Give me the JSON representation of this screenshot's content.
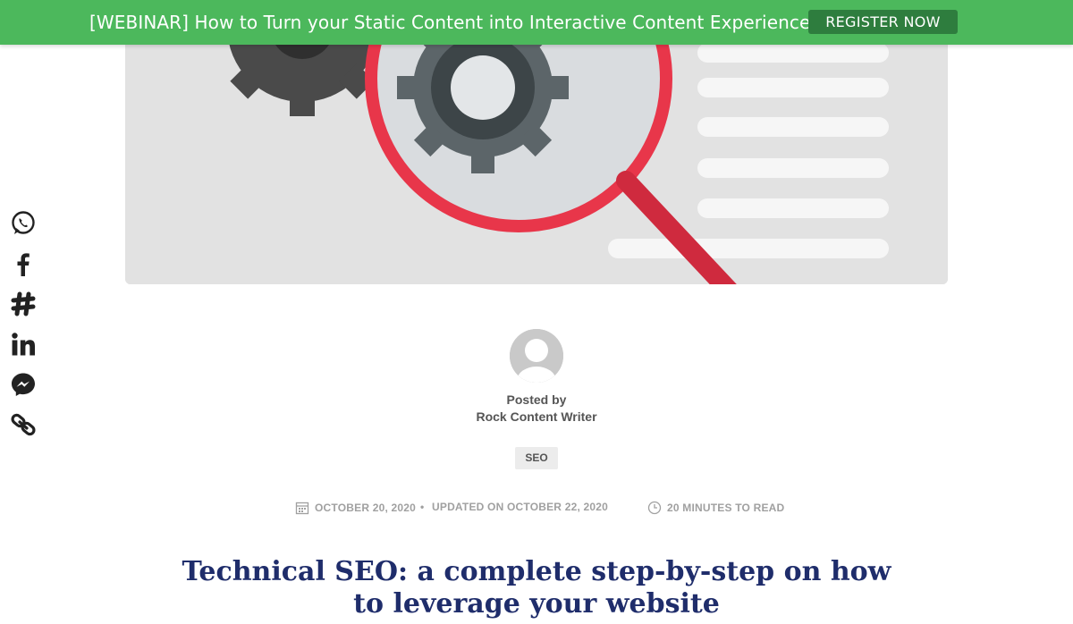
{
  "banner": {
    "text": "[WEBINAR] How to Turn your Static Content into Interactive Content Experiences",
    "button_label": "REGISTER NOW",
    "bg_color": "#4cb85c",
    "button_color": "#2e7d3e"
  },
  "share": {
    "items": [
      {
        "icon": "whatsapp-icon"
      },
      {
        "icon": "facebook-icon"
      },
      {
        "icon": "slack-icon"
      },
      {
        "icon": "linkedin-icon"
      },
      {
        "icon": "messenger-icon"
      },
      {
        "icon": "link-icon"
      }
    ]
  },
  "author": {
    "posted_by_label": "Posted by",
    "name": "Rock Content Writer"
  },
  "tag": {
    "label": "SEO"
  },
  "meta": {
    "date": "OCTOBER 20, 2020",
    "separator": "•",
    "updated": "UPDATED ON OCTOBER 22, 2020",
    "read_time": "20 MINUTES TO READ"
  },
  "article": {
    "title": "Technical SEO: a complete step-by-step on how to leverage your website",
    "title_color": "#1f2d6b"
  }
}
